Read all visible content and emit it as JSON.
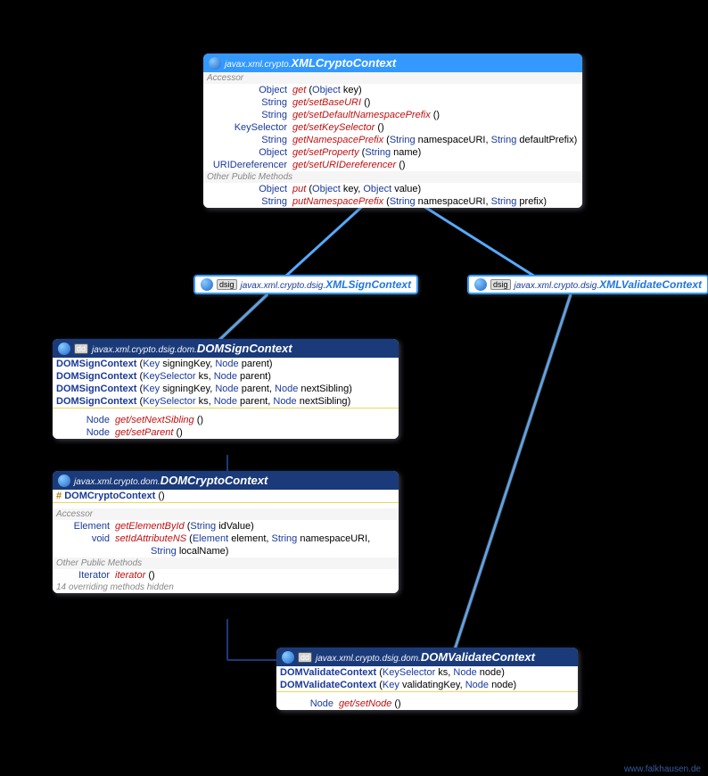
{
  "footer": "www.falkhausen.de",
  "xmlCryptoContext": {
    "pkg": "javax.xml.crypto.",
    "cls": "XMLCryptoContext",
    "accessorLabel": "Accessor",
    "otherLabel": "Other Public Methods",
    "accessors": [
      {
        "ret": "Object",
        "name": "get",
        "params": [
          {
            "t": "Object",
            "n": "key"
          }
        ]
      },
      {
        "ret": "String",
        "name": "get/setBaseURI",
        "params": []
      },
      {
        "ret": "String",
        "name": "get/setDefaultNamespacePrefix",
        "params": []
      },
      {
        "ret": "KeySelector",
        "name": "get/setKeySelector",
        "params": []
      },
      {
        "ret": "String",
        "name": "getNamespacePrefix",
        "params": [
          {
            "t": "String",
            "n": "namespaceURI"
          },
          {
            "t": "String",
            "n": "defaultPrefix"
          }
        ]
      },
      {
        "ret": "Object",
        "name": "get/setProperty",
        "params": [
          {
            "t": "String",
            "n": "name"
          }
        ]
      },
      {
        "ret": "URIDereferencer",
        "name": "get/setURIDereferencer",
        "params": []
      }
    ],
    "others": [
      {
        "ret": "Object",
        "name": "put",
        "params": [
          {
            "t": "Object",
            "n": "key"
          },
          {
            "t": "Object",
            "n": "value"
          }
        ]
      },
      {
        "ret": "String",
        "name": "putNamespacePrefix",
        "params": [
          {
            "t": "String",
            "n": "namespaceURI"
          },
          {
            "t": "String",
            "n": "prefix"
          }
        ]
      }
    ]
  },
  "xmlSignContext": {
    "tag": "dsig",
    "pkg": "javax.xml.crypto.dsig.",
    "cls": "XMLSignContext"
  },
  "xmlValidateContext": {
    "tag": "dsig",
    "pkg": "javax.xml.crypto.dsig.",
    "cls": "XMLValidateContext"
  },
  "domSignContext": {
    "tag": "dd",
    "pkg": "javax.xml.crypto.dsig.dom.",
    "cls": "DOMSignContext",
    "ctors": [
      {
        "name": "DOMSignContext",
        "params": [
          {
            "t": "Key",
            "n": "signingKey"
          },
          {
            "t": "Node",
            "n": "parent"
          }
        ]
      },
      {
        "name": "DOMSignContext",
        "params": [
          {
            "t": "KeySelector",
            "n": "ks"
          },
          {
            "t": "Node",
            "n": "parent"
          }
        ]
      },
      {
        "name": "DOMSignContext",
        "params": [
          {
            "t": "Key",
            "n": "signingKey"
          },
          {
            "t": "Node",
            "n": "parent"
          },
          {
            "t": "Node",
            "n": "nextSibling"
          }
        ]
      },
      {
        "name": "DOMSignContext",
        "params": [
          {
            "t": "KeySelector",
            "n": "ks"
          },
          {
            "t": "Node",
            "n": "parent"
          },
          {
            "t": "Node",
            "n": "nextSibling"
          }
        ]
      }
    ],
    "methods": [
      {
        "ret": "Node",
        "name": "get/setNextSibling",
        "params": []
      },
      {
        "ret": "Node",
        "name": "get/setParent",
        "params": []
      }
    ]
  },
  "domCryptoContext": {
    "pkg": "javax.xml.crypto.dom.",
    "cls": "DOMCryptoContext",
    "protectedCtor": "DOMCryptoContext",
    "accessorLabel": "Accessor",
    "otherLabel": "Other Public Methods",
    "accessors": [
      {
        "ret": "Element",
        "name": "getElementById",
        "params": [
          {
            "t": "String",
            "n": "idValue"
          }
        ]
      },
      {
        "ret": "void",
        "name": "setIdAttributeNS",
        "params": [
          {
            "t": "Element",
            "n": "element"
          },
          {
            "t": "String",
            "n": "namespaceURI"
          },
          {
            "t": "String",
            "n": "localName"
          }
        ],
        "wrap": true
      }
    ],
    "others": [
      {
        "ret": "Iterator",
        "name": "iterator",
        "params": []
      }
    ],
    "hidden": "14 overriding methods hidden"
  },
  "domValidateContext": {
    "tag": "dd",
    "pkg": "javax.xml.crypto.dsig.dom.",
    "cls": "DOMValidateContext",
    "ctors": [
      {
        "name": "DOMValidateContext",
        "params": [
          {
            "t": "KeySelector",
            "n": "ks"
          },
          {
            "t": "Node",
            "n": "node"
          }
        ]
      },
      {
        "name": "DOMValidateContext",
        "params": [
          {
            "t": "Key",
            "n": "validatingKey"
          },
          {
            "t": "Node",
            "n": "node"
          }
        ]
      }
    ],
    "methods": [
      {
        "ret": "Node",
        "name": "get/setNode",
        "params": []
      }
    ]
  }
}
